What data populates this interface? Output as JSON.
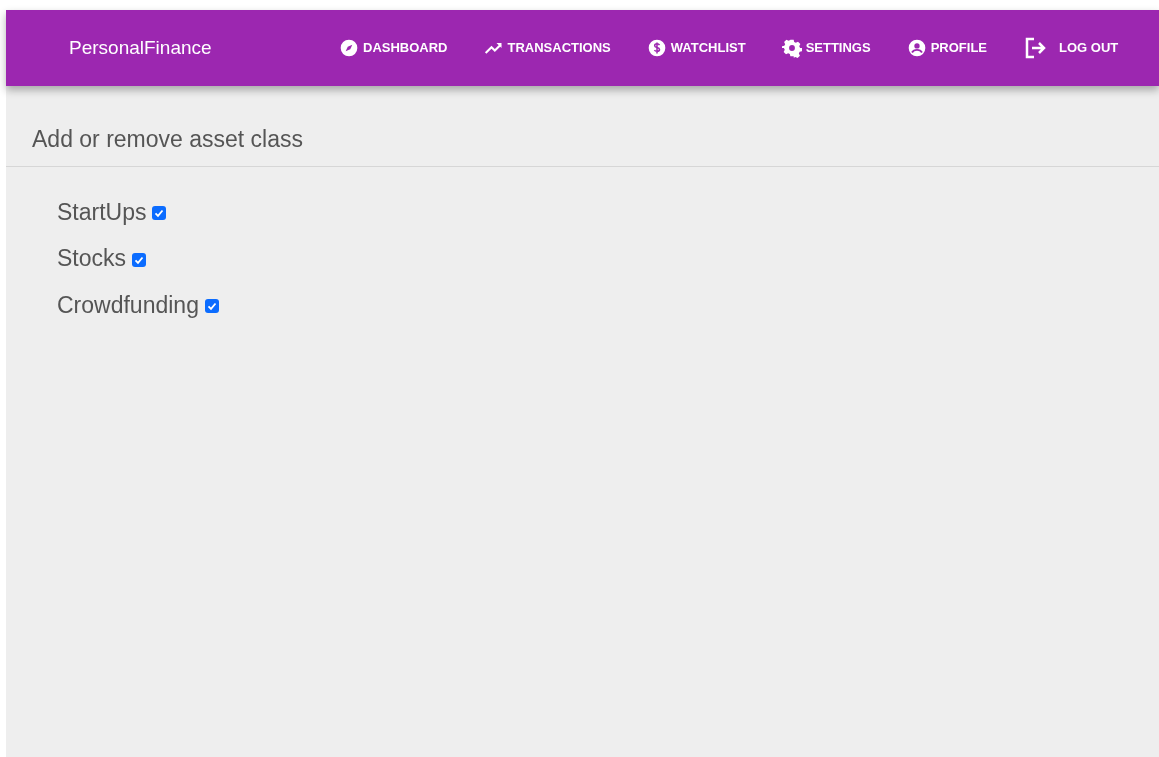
{
  "brand": "PersonalFinance",
  "nav": [
    {
      "kind": "compass",
      "label": "DASHBOARD"
    },
    {
      "kind": "trend",
      "label": "TRANSACTIONS"
    },
    {
      "kind": "dollar",
      "label": "WATCHLIST"
    },
    {
      "kind": "gear",
      "label": "SETTINGS"
    },
    {
      "kind": "person",
      "label": "PROFILE"
    },
    {
      "kind": "logout",
      "label": "LOG OUT"
    }
  ],
  "heading": "Add or remove asset class",
  "asset_classes": [
    {
      "label": "StartUps",
      "checked": true
    },
    {
      "label": "Stocks",
      "checked": true
    },
    {
      "label": "Crowdfunding",
      "checked": true
    }
  ]
}
